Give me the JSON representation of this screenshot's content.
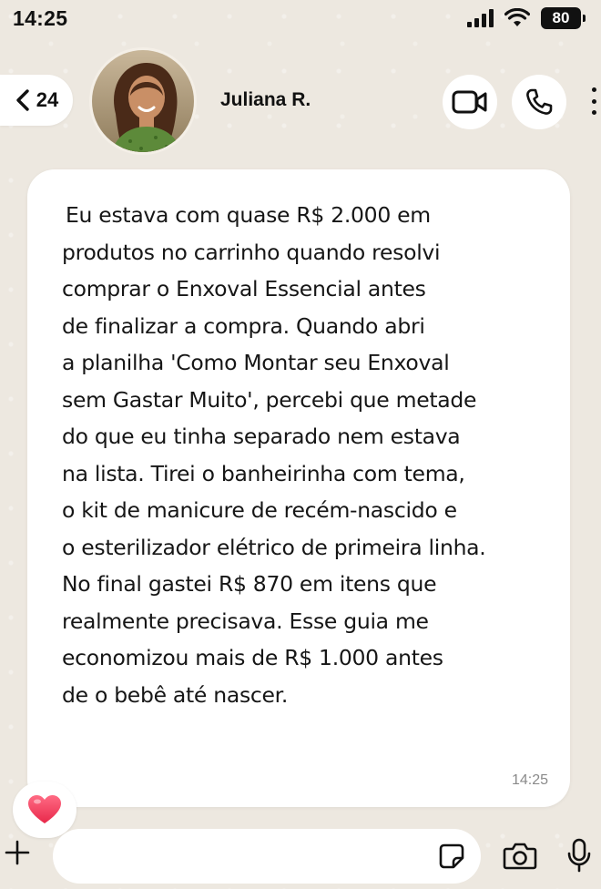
{
  "status_bar": {
    "time": "14:25",
    "battery": "80",
    "icons": [
      "signal-icon",
      "wifi-icon",
      "battery-icon"
    ]
  },
  "header": {
    "back_count": "24",
    "contact_name": "Juliana R.",
    "icons": [
      "chevron-left-icon",
      "video-call-icon",
      "phone-icon",
      "more-vertical-icon"
    ]
  },
  "message": {
    "lines": [
      "Eu estava com quase R$ 2.000 em",
      "produtos no carrinho quando resolvi",
      "comprar o Enxoval Essencial antes",
      "de finalizar a compra. Quando abri",
      "a planilha 'Como Montar seu Enxoval",
      "sem Gastar Muito', percebi que metade",
      "do que eu tinha separado nem estava",
      "na lista. Tirei o banheirinha com tema,",
      "o kit de manicure de recém-nascido e",
      "o esterilizador elétrico de primeira linha.",
      "No final gastei R$ 870 em itens que",
      "realmente precisava. Esse guia me",
      "economizou mais de R$ 1.000 antes",
      "de o bebê até nascer."
    ],
    "time": "14:25",
    "reaction": "heart-icon"
  },
  "composer": {
    "placeholder": "",
    "icons": [
      "plus-icon",
      "sticker-icon",
      "camera-icon",
      "microphone-icon"
    ]
  },
  "colors": {
    "background": "#ede8e0",
    "bubble": "#ffffff",
    "text": "#161616",
    "timestamp": "#8a8a8a",
    "heart": "#f0405c"
  }
}
